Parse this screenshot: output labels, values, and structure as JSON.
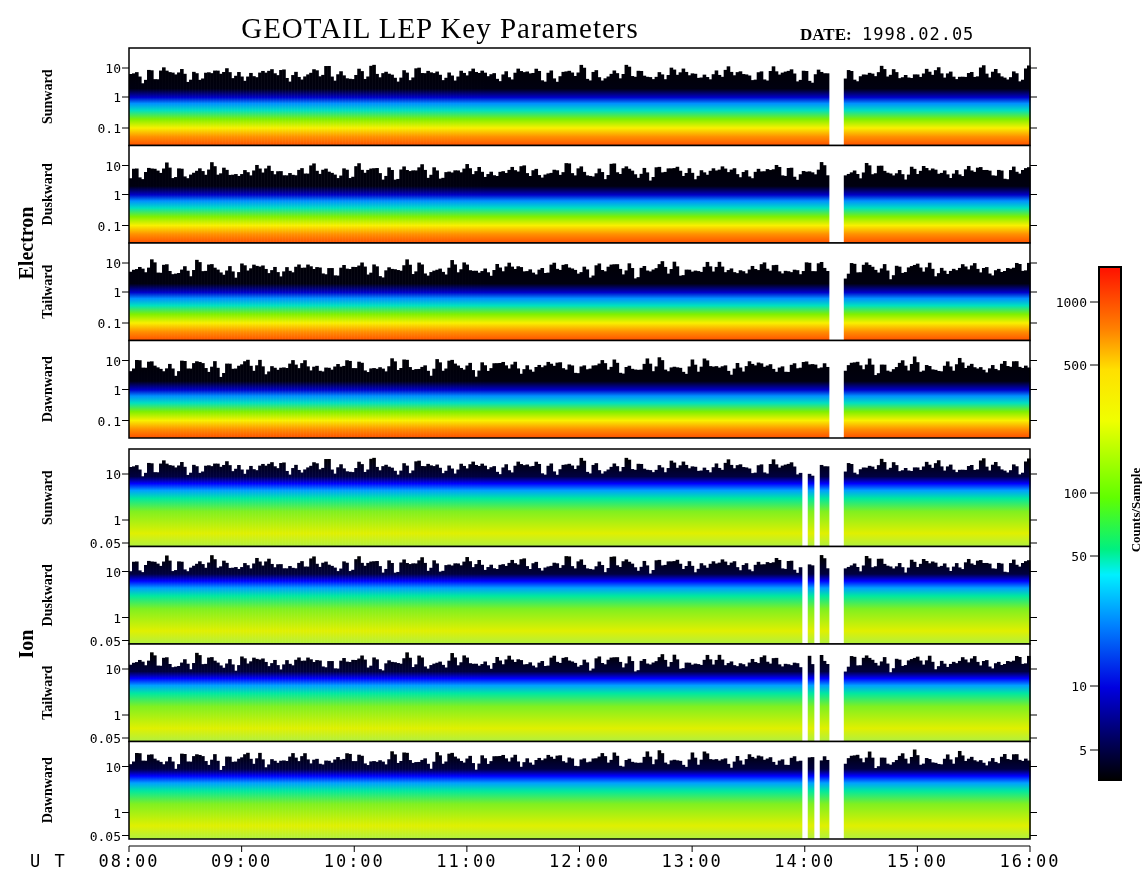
{
  "title": "GEOTAIL LEP Key Parameters",
  "date": {
    "label": "DATE:",
    "value": "1998.02.05"
  },
  "groups": [
    {
      "name": "Electron",
      "kind": "electron",
      "panels": [
        {
          "label": "Sunward",
          "yticks": [
            "10",
            "1",
            "0.1"
          ]
        },
        {
          "label": "Duskward",
          "yticks": [
            "10",
            "1",
            "0.1"
          ]
        },
        {
          "label": "Tailward",
          "yticks": [
            "10",
            "1",
            "0.1"
          ]
        },
        {
          "label": "Dawnward",
          "yticks": [
            "10",
            "1",
            "0.1"
          ]
        }
      ]
    },
    {
      "name": "Ion",
      "kind": "ion",
      "panels": [
        {
          "label": "Sunward",
          "yticks": [
            "10",
            "1",
            "0.05"
          ]
        },
        {
          "label": "Duskward",
          "yticks": [
            "10",
            "1",
            "0.05"
          ]
        },
        {
          "label": "Tailward",
          "yticks": [
            "10",
            "1",
            "0.05"
          ]
        },
        {
          "label": "Dawnward",
          "yticks": [
            "10",
            "1",
            "0.05"
          ]
        }
      ]
    }
  ],
  "x_axis": {
    "label": "U T",
    "ticks": [
      "08:00",
      "09:00",
      "10:00",
      "11:00",
      "12:00",
      "13:00",
      "14:00",
      "15:00",
      "16:00"
    ]
  },
  "colorbar": {
    "title": "Counts/Sample",
    "ticks": [
      "1000",
      "500",
      "100",
      "50",
      "10",
      "5"
    ]
  }
}
